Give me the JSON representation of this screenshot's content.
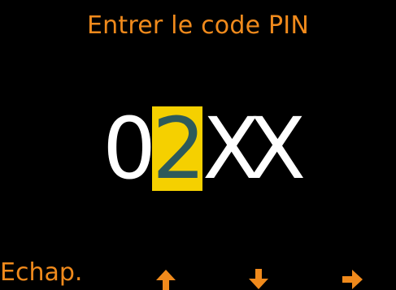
{
  "screen": {
    "title": "Entrer le code PIN",
    "pin_digits": [
      "0",
      "2",
      "X",
      "X"
    ],
    "selected_index": 1
  },
  "softkeys": {
    "escape_label": "Echap.",
    "up_icon": "arrow-up-icon",
    "down_icon": "arrow-down-icon",
    "right_icon": "arrow-right-icon"
  },
  "colors": {
    "background": "#000000",
    "accent": "#f08a1c",
    "pin_text": "#ffffff",
    "highlight": "#f5d000",
    "highlight_text": "#2e5a5a"
  }
}
